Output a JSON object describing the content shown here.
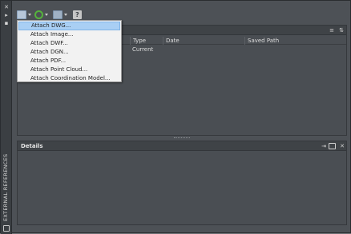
{
  "palette": {
    "title": "EXTERNAL REFERENCES",
    "close_glyph": "✕",
    "autohide_glyph": "▸",
    "properties_glyph": "▪"
  },
  "toolbar": {
    "icons": [
      "attach-dwg-icon",
      "refresh-icon",
      "change-path-icon",
      "help-icon"
    ],
    "help_glyph": "?"
  },
  "references": {
    "header_icons": [
      "list-view-icon",
      "tree-view-icon"
    ],
    "list_glyph": "≡",
    "tree_glyph": "⇅",
    "columns": [
      "Type",
      "Date",
      "Saved Path"
    ],
    "rows": [
      {
        "type": "Current",
        "date": "",
        "saved_path": ""
      }
    ]
  },
  "details": {
    "title": "Details",
    "icons": [
      "toggle-preview-icon",
      "preview-image-icon",
      "collapse-icon"
    ],
    "toggle_glyph": "⇥",
    "collapse_glyph": "✕"
  },
  "attach_menu": {
    "highlighted_index": 0,
    "items": [
      {
        "label": "Attach DWG..."
      },
      {
        "label": "Attach Image..."
      },
      {
        "label": "Attach DWF..."
      },
      {
        "label": "Attach DGN..."
      },
      {
        "label": "Attach PDF..."
      },
      {
        "label": "Attach Point Cloud..."
      },
      {
        "label": "Attach Coordination Model..."
      }
    ]
  }
}
